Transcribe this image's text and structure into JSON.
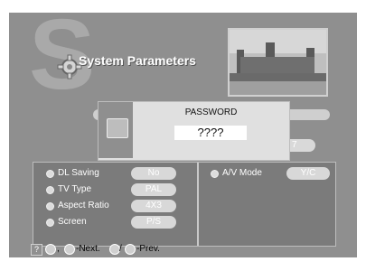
{
  "header": {
    "title": "System Parameters",
    "watermark_letter": "S"
  },
  "icons": {
    "gear": "gear-icon",
    "lock": "lock-icon",
    "help": "help-icon",
    "circle": "circle-button-icon"
  },
  "hidden_field": {
    "value": "7"
  },
  "password_dialog": {
    "title": "PASSWORD",
    "value": "????"
  },
  "settings": {
    "left": [
      {
        "label": "DL Saving",
        "value": "No"
      },
      {
        "label": "TV Type",
        "value": "PAL"
      },
      {
        "label": "Aspect Ratio",
        "value": "4X3"
      },
      {
        "label": "Screen",
        "value": "P/S"
      }
    ],
    "right": [
      {
        "label": "A/V Mode",
        "value": "Y/C"
      }
    ]
  },
  "footer": {
    "help": "?",
    "sep": ",",
    "next": "-Next.",
    "slash": "/",
    "prev": "-Prev."
  },
  "colors": {
    "background": "#8f8f8f",
    "panel": "#7b7b7b",
    "dialog": "#e0e0e0"
  }
}
